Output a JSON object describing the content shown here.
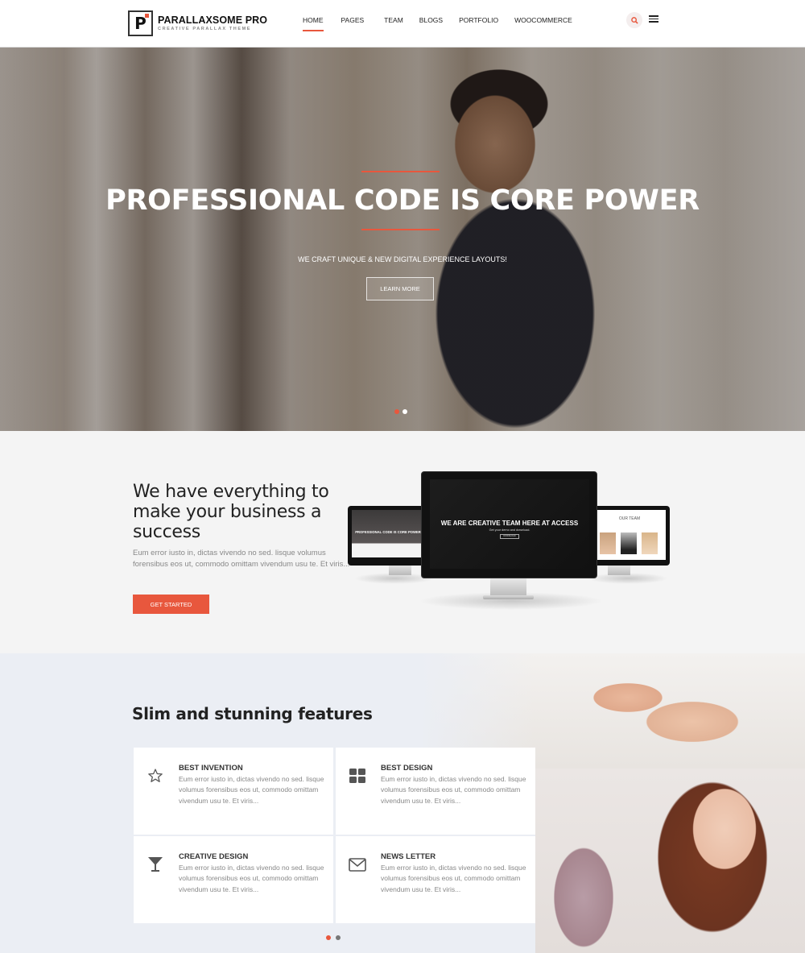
{
  "colors": {
    "accent": "#e8573d",
    "dark": "#222222",
    "muted": "#888888",
    "dot_inactive": "#777777"
  },
  "header": {
    "logo": {
      "letter": "P",
      "title": "PARALLAXSOME PRO",
      "subtitle": "CREATIVE PARALLAX THEME"
    },
    "nav": [
      {
        "label": "HOME",
        "active": true
      },
      {
        "label": "PAGES",
        "active": false
      },
      {
        "label": "TEAM",
        "active": false
      },
      {
        "label": "BLOGS",
        "active": false
      },
      {
        "label": "PORTFOLIO",
        "active": false
      },
      {
        "label": "WOOCOMMERCE",
        "active": false
      }
    ],
    "search_icon": "search-icon",
    "menu_icon": "hamburger-menu-icon"
  },
  "hero": {
    "title": "PROFESSIONAL CODE IS CORE POWER",
    "subtitle": "WE CRAFT UNIQUE & NEW DIGITAL EXPERIENCE LAYOUTS!",
    "button": "LEARN MORE",
    "slides": 2,
    "active_slide": 1
  },
  "intro": {
    "title": "We have everything to make your business a success",
    "text": "Eum error iusto in, dictas vivendo no sed. lisque volumus forensibus eos ut, commodo omittam vivendum usu te. Et viris...",
    "button": "GET STARTED",
    "mockups": {
      "left_screen_title": "PROFESSIONAL CODE IS CORE POWER",
      "center_screen_title": "WE ARE CREATIVE TEAM HERE AT ACCESS",
      "center_screen_sub": "Get your demo and download.",
      "center_screen_button": "DOWNLOAD",
      "right_screen_title": "OUR TEAM"
    }
  },
  "features": {
    "title": "Slim and stunning features",
    "items": [
      {
        "icon": "star-icon",
        "title": "BEST INVENTION",
        "text": "Eum error iusto in, dictas vivendo no sed. lisque volumus forensibus eos ut, commodo omittam vivendum usu te. Et viris..."
      },
      {
        "icon": "grid-icon",
        "title": "BEST DESIGN",
        "text": "Eum error iusto in, dictas vivendo no sed. lisque volumus forensibus eos ut, commodo omittam vivendum usu te. Et viris..."
      },
      {
        "icon": "cocktail-glass-icon",
        "title": "CREATIVE DESIGN",
        "text": "Eum error iusto in, dictas vivendo no sed. lisque volumus forensibus eos ut, commodo omittam vivendum usu te. Et viris..."
      },
      {
        "icon": "envelope-icon",
        "title": "NEWS LETTER",
        "text": "Eum error iusto in, dictas vivendo no sed. lisque volumus forensibus eos ut, commodo omittam vivendum usu te. Et viris..."
      }
    ],
    "slides": 2,
    "active_slide": 1
  }
}
